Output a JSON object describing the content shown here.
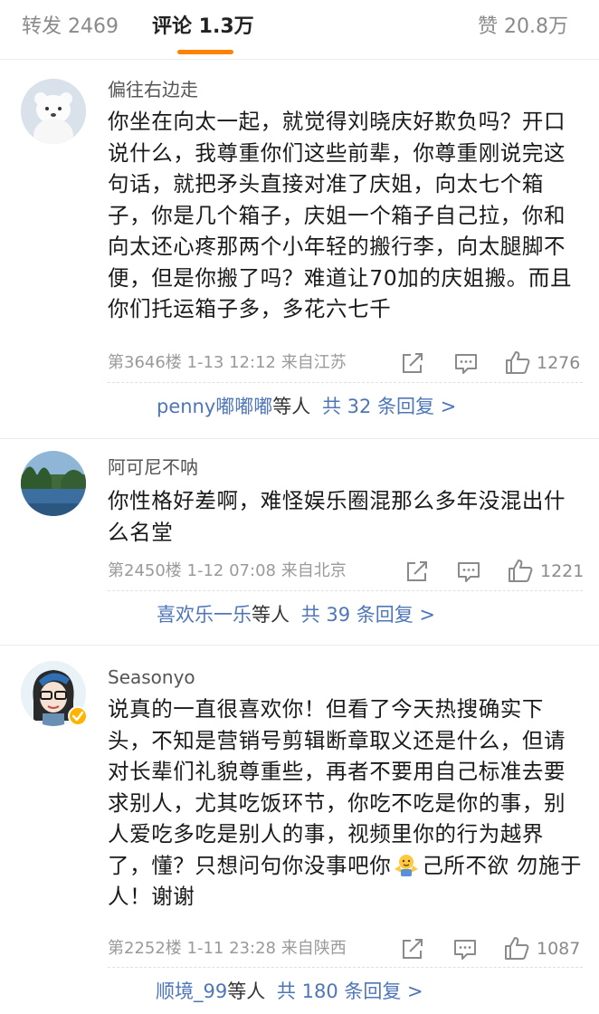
{
  "tabs": {
    "repost": "转发 2469",
    "comment": "评论 1.3万",
    "like": "赞 20.8万"
  },
  "comments": [
    {
      "username": "偏往右边走",
      "content": "你坐在向太一起，就觉得刘晓庆好欺负吗？开口说什么，我尊重你们这些前辈，你尊重刚说完这句话，就把矛头直接对准了庆姐，向太七个箱子，你是几个箱子，庆姐一个箱子自己拉，你和向太还心疼那两个小年轻的搬行李，向太腿脚不便，但是你搬了吗？难道让70加的庆姐搬。而且你们托运箱子多，多花六七千",
      "meta": "第3646楼 1-13 12:12 来自江苏",
      "likes": "1276",
      "reply_user": "penny嘟嘟嘟",
      "reply_mid": "等人",
      "reply_count": "共 32 条回复 >"
    },
    {
      "username": "阿可尼不呐",
      "content": "你性格好差啊，难怪娱乐圈混那么多年没混出什么名堂",
      "meta": "第2450楼 1-12 07:08 来自北京",
      "likes": "1221",
      "reply_user": "喜欢乐一乐",
      "reply_mid": "等人",
      "reply_count": "共 39 条回复 >"
    },
    {
      "username": "Seasonyo",
      "content_a": "说真的一直很喜欢你！但看了今天热搜确实下头，不知是营销号剪辑断章取义还是什么，但请对长辈们礼貌尊重些，再者不要用自己标准去要求别人，尤其吃饭环节，你吃不吃是你的事，别人爱吃多吃是别人的事，视频里你的行为越界了，懂？只想问句你没事吧你",
      "content_b": "己所不欲 勿施于人！谢谢",
      "emoji": "shrug-emoji",
      "meta": "第2252楼 1-11 23:28 来自陕西",
      "likes": "1087",
      "reply_user": "顺境_99",
      "reply_mid": "等人",
      "reply_count": "共 180 条回复 >"
    }
  ],
  "colors": {
    "accent": "#ff8200",
    "link": "#4e76b8",
    "badge": "#ffb400"
  }
}
